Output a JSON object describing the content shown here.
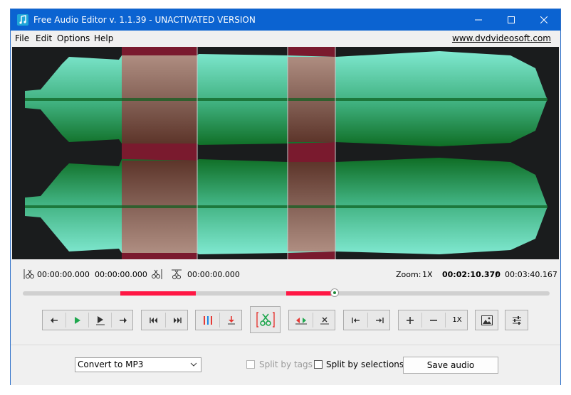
{
  "window": {
    "title": "Free Audio Editor v. 1.1.39 - UNACTIVATED VERSION"
  },
  "menu": {
    "items": [
      "File",
      "Edit",
      "Options",
      "Help"
    ],
    "site_link": "www.dvdvideosoft.com"
  },
  "colors": {
    "titlebar": "#0b63d1",
    "wave_green": "#1f8a3a",
    "wave_cyan": "#6fe0c4",
    "wave_bg": "#1a1c1d",
    "selection_red": "#7a1a2e",
    "selection_bar": "#ff1744"
  },
  "timeline": {
    "selection_start": "00:00:00.000",
    "selection_end": "00:00:00.000",
    "cut_time": "00:00:00.000",
    "zoom_label": "Zoom:",
    "zoom_value": "1X",
    "current_time": "00:02:10.370",
    "separator": "/",
    "total_time": "00:03:40.167",
    "playhead_fraction": 0.592
  },
  "toolbar": {
    "zoom_level": "1X",
    "icons": [
      "back-icon",
      "play-icon",
      "play-selection-icon",
      "forward-icon",
      "skip-start-icon",
      "skip-end-icon",
      "split-markers-icon",
      "download-marker-icon",
      "cut-icon",
      "insert-silence-icon",
      "delete-icon",
      "go-start-icon",
      "go-end-icon",
      "zoom-in-icon",
      "zoom-out-icon",
      "zoom-reset-icon",
      "image-icon",
      "settings-icon"
    ]
  },
  "bottom": {
    "format_select": "Convert to MP3",
    "split_by_tags": "Split by tags",
    "split_by_selections": "Split by selections",
    "save_button": "Save audio"
  }
}
